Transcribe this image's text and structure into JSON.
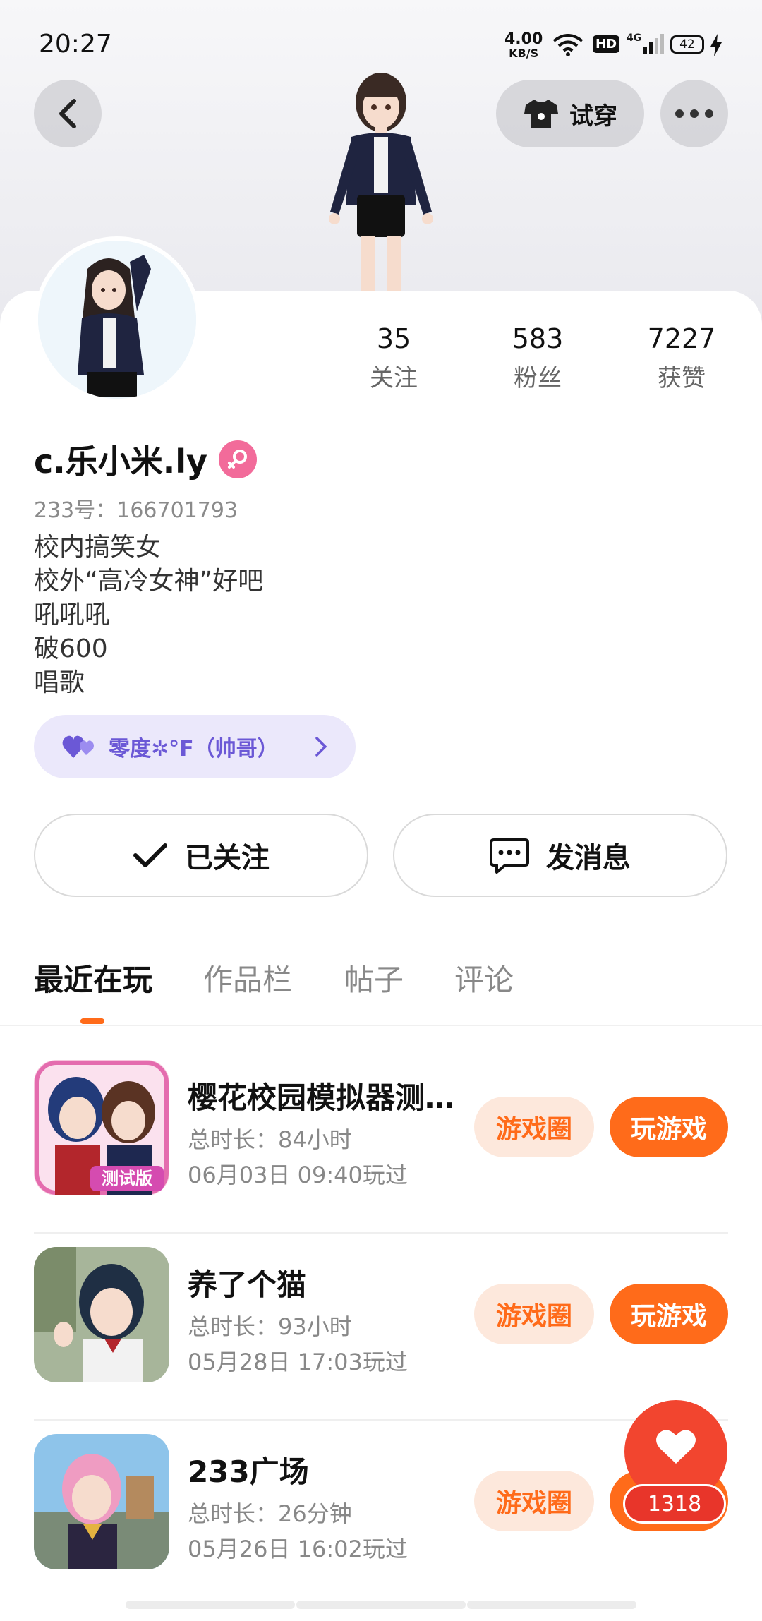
{
  "status_bar": {
    "time": "20:27",
    "net_speed": "4.00",
    "net_unit": "KB/S",
    "hd": "HD",
    "signal": "4G",
    "battery": "42"
  },
  "header": {
    "tryon_label": "试穿"
  },
  "stats": [
    {
      "value": "35",
      "label": "关注"
    },
    {
      "value": "583",
      "label": "粉丝"
    },
    {
      "value": "7227",
      "label": "获赞"
    }
  ],
  "profile": {
    "name": "c.乐小米.ly",
    "uid": "233号：166701793",
    "bio": [
      "校内搞笑女",
      "校外“高冷女神”好吧",
      "吼吼吼",
      "破600",
      "唱歌"
    ],
    "fan_tag": "零度✲°F（帅哥）"
  },
  "actions": {
    "follow_label": "已关注",
    "message_label": "发消息"
  },
  "tabs": [
    "最近在玩",
    "作品栏",
    "帖子",
    "评论"
  ],
  "games": [
    {
      "title": "樱花校园模拟器测试版",
      "duration": "总时长：84小时",
      "last_played": "06月03日 09:40玩过",
      "circle_label": "游戏圈",
      "play_label": "玩游戏",
      "badge": "测试版"
    },
    {
      "title": "养了个猫",
      "duration": "总时长：93小时",
      "last_played": "05月28日 17:03玩过",
      "circle_label": "游戏圈",
      "play_label": "玩游戏"
    },
    {
      "title": "233广场",
      "duration": "总时长：26分钟",
      "last_played": "05月26日 16:02玩过",
      "circle_label": "游戏圈",
      "play_label": "玩游戏"
    }
  ],
  "like": {
    "count": "1318"
  },
  "colors": {
    "accent": "#ff6b1a",
    "like_red": "#f2452f",
    "gender_pink": "#f26b9a",
    "fan_tag_purple": "#6b58d6"
  }
}
